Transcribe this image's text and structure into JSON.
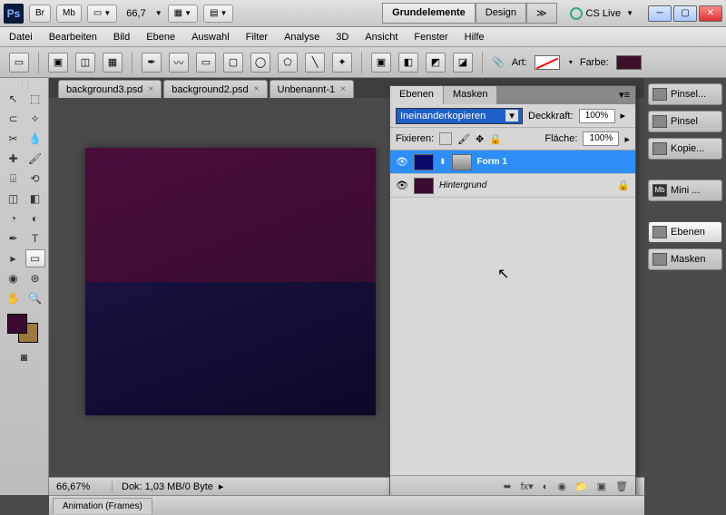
{
  "app": {
    "logo": "Ps"
  },
  "titlebar": {
    "badges": [
      "Br",
      "Mb"
    ],
    "zoom": "66,7",
    "workspaces": {
      "active": "Grundelemente",
      "other": "Design"
    },
    "cslive": "CS Live"
  },
  "menu": [
    "Datei",
    "Bearbeiten",
    "Bild",
    "Ebene",
    "Auswahl",
    "Filter",
    "Analyse",
    "3D",
    "Ansicht",
    "Fenster",
    "Hilfe"
  ],
  "options": {
    "art_label": "Art:",
    "farbe_label": "Farbe:",
    "farbe_color": "#3d1028"
  },
  "doc_tabs": [
    "background3.psd",
    "background2.psd",
    "Unbenannt-1"
  ],
  "status": {
    "zoom": "66,67%",
    "info": "Dok: 1,03 MB/0 Byte"
  },
  "right_panel": [
    "Pinsel...",
    "Pinsel",
    "Kopie...",
    "Mini ...",
    "Ebenen",
    "Masken"
  ],
  "right_panel_active_idx": 4,
  "layers_panel": {
    "tabs": [
      "Ebenen",
      "Masken"
    ],
    "blend_mode": "Ineinanderkopieren",
    "deckkraft_label": "Deckkraft:",
    "deckkraft": "100%",
    "fixieren_label": "Fixieren:",
    "flaeche_label": "Fläche:",
    "flaeche": "100%",
    "layers": [
      {
        "name": "Form 1",
        "color": "#0a0a6a",
        "selected": true,
        "hasMask": true
      },
      {
        "name": "Hintergrund",
        "color": "#3d0a32",
        "selected": false,
        "locked": true
      }
    ]
  },
  "bottom_panel": {
    "tab": "Animation (Frames)"
  },
  "colors": {
    "fg": "#3d0a32",
    "bg": "#9c7a3c"
  }
}
